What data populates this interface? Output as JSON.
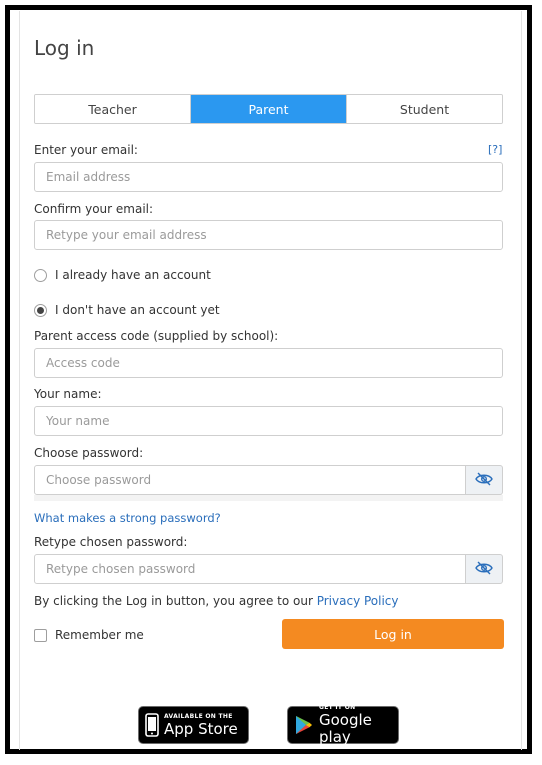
{
  "form": {
    "title": "Log in",
    "tabs": [
      {
        "label": "Teacher",
        "active": false
      },
      {
        "label": "Parent",
        "active": true
      },
      {
        "label": "Student",
        "active": false
      }
    ],
    "email_label": "Enter your email:",
    "email_help": "[?]",
    "email_placeholder": "Email address",
    "confirm_email_label": "Confirm your email:",
    "confirm_email_placeholder": "Retype your email address",
    "radio_have_account": "I already have an account",
    "radio_no_account": "I don't have an account yet",
    "access_code_label": "Parent access code (supplied by school):",
    "access_code_placeholder": "Access code",
    "name_label": "Your name:",
    "name_placeholder": "Your name",
    "password_label": "Choose password:",
    "password_placeholder": "Choose password",
    "strong_password_link": "What makes a strong password?",
    "retype_password_label": "Retype chosen password:",
    "retype_password_placeholder": "Retype chosen password",
    "agree_text": "By clicking the Log in button, you agree to our",
    "privacy_link": "Privacy Policy",
    "remember_me": "Remember me",
    "login_button": "Log in"
  },
  "stores": {
    "app_store_small": "AVAILABLE ON THE",
    "app_store_big": "App Store",
    "google_small": "GET IT ON",
    "google_big": "Google play"
  },
  "colors": {
    "active_tab": "#2b98f0",
    "login_button": "#f48a21",
    "link": "#2a6ebb"
  },
  "icons": {
    "password_toggle": "eye-slash-icon",
    "app_store": "phone-icon",
    "google_play": "play-triangle-icon"
  }
}
